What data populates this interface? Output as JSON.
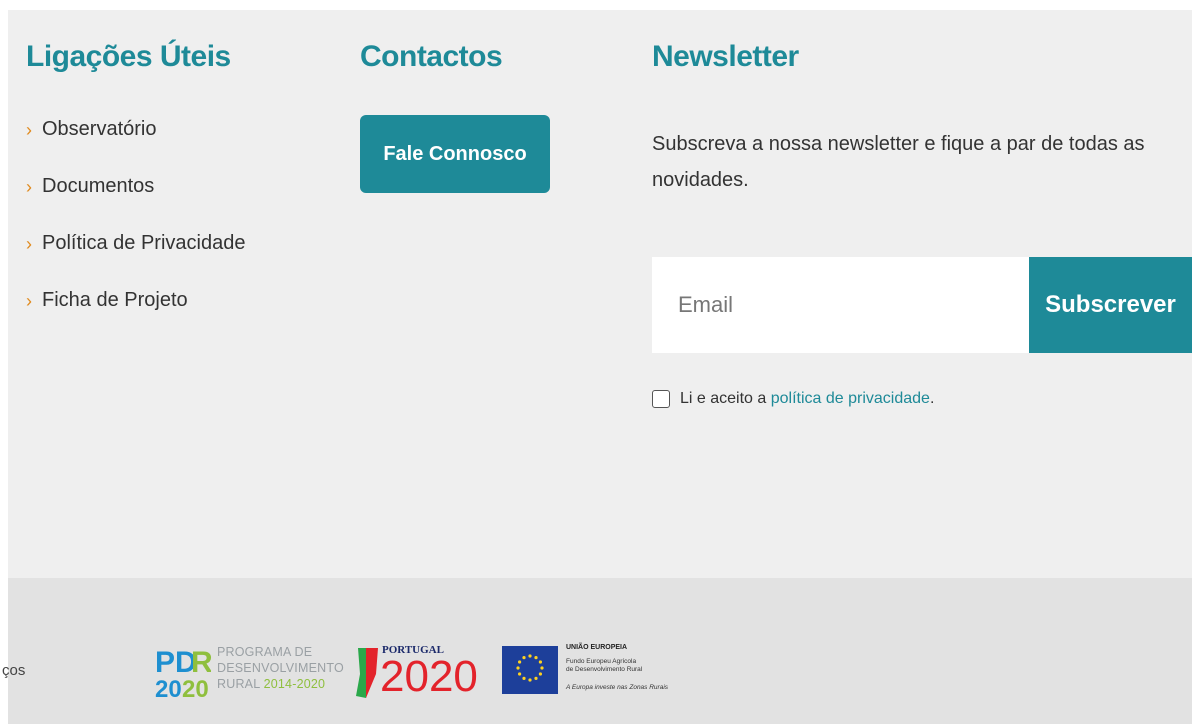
{
  "useful_links": {
    "title": "Ligações Úteis",
    "items": [
      {
        "label": "Observatório"
      },
      {
        "label": "Documentos"
      },
      {
        "label": "Política de Privacidade"
      },
      {
        "label": "Ficha de Projeto"
      }
    ]
  },
  "contacts": {
    "title": "Contactos",
    "button_label": "Fale Connosco"
  },
  "newsletter": {
    "title": "Newsletter",
    "description": "Subscreva a nossa newsletter e fique a par de todas as novidades.",
    "email_placeholder": "Email",
    "email_value": "",
    "subscribe_label": "Subscrever",
    "consent_prefix": "Li e aceito a ",
    "consent_link": "política de privacidade",
    "consent_suffix": "."
  },
  "bottom_bar": {
    "partial_text": "ços",
    "pdr_logo": {
      "mark": "PDR 2020",
      "line1": "PROGRAMA DE",
      "line2": "DESENVOLVIMENTO",
      "line3_prefix": "RURAL ",
      "line3_years": "2014-2020"
    },
    "portugal_logo": {
      "label": "PORTUGAL",
      "year": "2020"
    },
    "eu_logo": {
      "title": "UNIÃO EUROPEIA",
      "line1": "Fundo Europeu Agrícola",
      "line2": "de Desenvolvimento Rural",
      "line3": "A Europa investe nas Zonas Rurais"
    }
  },
  "colors": {
    "accent": "#1e8a98",
    "chevron": "#e08a1e",
    "footer_bg": "#efefef",
    "bottom_bg": "#e2e2e2"
  }
}
